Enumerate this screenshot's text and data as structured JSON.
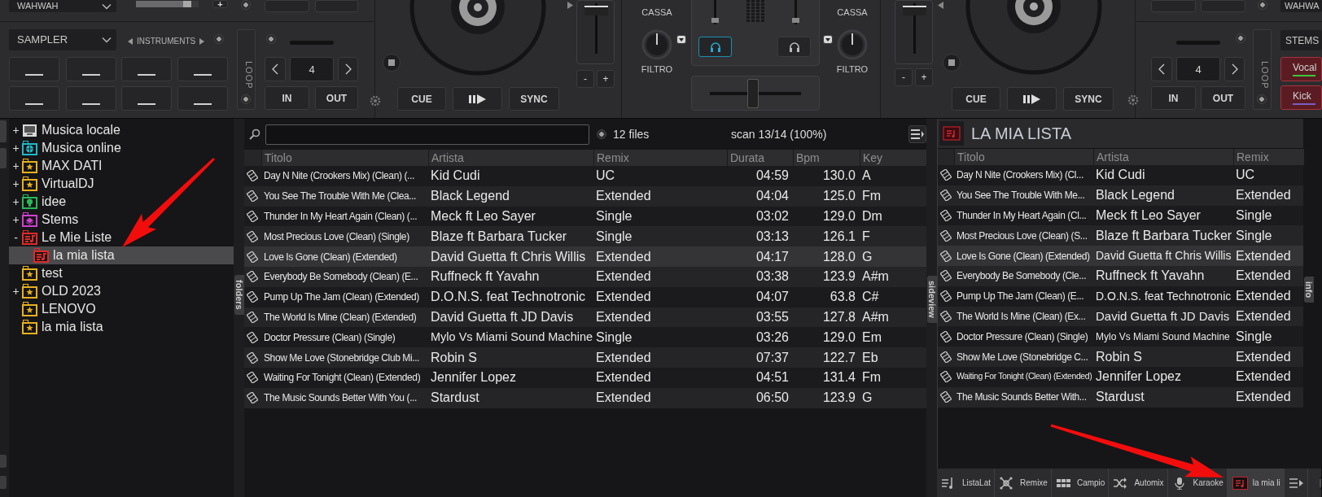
{
  "left_deck": {
    "effect": "WAHWAH",
    "effect_plus": "+",
    "effect_slider": {
      "level": 0.88
    },
    "sampler": "SAMPLER",
    "instruments": "INSTRUMENTS",
    "loop_label": "LOOP",
    "loop_size": "4",
    "loop_in": "IN",
    "loop_out": "OUT",
    "cue": "CUE",
    "sync": "SYNC",
    "pitch": {
      "level": 0.95
    },
    "pitch_minus": "-",
    "pitch_plus": "+"
  },
  "mixer": {
    "channels": [
      {
        "eq_label": "CASSA",
        "filter_label": "FILTRO",
        "volume": {
          "level": 0.1
        },
        "headphone_on": true
      },
      {
        "eq_label": "CASSA",
        "filter_label": "FILTRO",
        "volume": {
          "level": 0.1
        },
        "headphone_on": false
      }
    ],
    "crossfader": {
      "level": 0.47
    }
  },
  "right_deck": {
    "effect": "WAHWA",
    "stems": "STEMS",
    "stem_buttons": [
      {
        "label": "Vocal",
        "color": "#3cc43c"
      },
      {
        "label": "Kick",
        "color": "#7a5cc8"
      }
    ],
    "loop_label": "LOOP",
    "loop_size": "4",
    "loop_in": "IN",
    "loop_out": "OUT",
    "cue": "CUE",
    "sync": "SYNC",
    "pitch": {
      "level": 0.95
    },
    "pitch_minus": "-",
    "pitch_plus": "+"
  },
  "folders": [
    {
      "label": "Musica locale",
      "kind": "computer",
      "color": "#d8d8d8",
      "toggle": "+",
      "selected": false
    },
    {
      "label": "Musica online",
      "kind": "globe",
      "color": "#20b8c8",
      "toggle": "+",
      "selected": false
    },
    {
      "label": "MAX DATI",
      "kind": "star",
      "color": "#e8b020",
      "toggle": "+",
      "selected": false
    },
    {
      "label": "VirtualDJ",
      "kind": "star",
      "color": "#e8b020",
      "toggle": "+",
      "selected": false
    },
    {
      "label": "idee",
      "kind": "bulb",
      "color": "#28b858",
      "toggle": "+",
      "selected": false
    },
    {
      "label": "Stems",
      "kind": "stems",
      "color": "#d040d0",
      "toggle": "+",
      "selected": false
    },
    {
      "label": "Le Mie Liste",
      "kind": "playlist",
      "color": "#e02a2a",
      "toggle": "-",
      "selected": false,
      "children": [
        {
          "label": "la mia lista",
          "kind": "playlist",
          "color": "#e02a2a",
          "selected": true
        }
      ]
    },
    {
      "label": "test",
      "kind": "star",
      "color": "#e8b020",
      "selected": false
    },
    {
      "label": "OLD 2023",
      "kind": "star",
      "color": "#e8b020",
      "toggle": "+",
      "selected": false
    },
    {
      "label": "LENOVO",
      "kind": "star",
      "color": "#e8b020",
      "selected": false
    },
    {
      "label": "la mia lista",
      "kind": "star",
      "color": "#e8b020",
      "selected": false
    }
  ],
  "folders_tab": "folders",
  "browser": {
    "file_count": "12 files",
    "scan_status": "scan 13/14 (100%)",
    "columns": [
      "Titolo",
      "Artista",
      "Remix",
      "Durata",
      "Bpm",
      "Key"
    ],
    "rows": [
      {
        "title": "Day N Nite (Crookers Mix) (Clean) (...",
        "artist": "Kid Cudi",
        "remix": "UC",
        "duration": "04:59",
        "bpm": "130.0",
        "key": "A",
        "selected": false
      },
      {
        "title": "You See The Trouble With Me (Clea...",
        "artist": "Black Legend",
        "remix": "Extended",
        "duration": "04:04",
        "bpm": "125.0",
        "key": "Fm",
        "selected": false
      },
      {
        "title": "Thunder In My Heart Again (Clean) (...",
        "artist": "Meck ft Leo Sayer",
        "remix": "Single",
        "duration": "03:02",
        "bpm": "129.0",
        "key": "Dm",
        "selected": false
      },
      {
        "title": "Most Precious Love (Clean) (Single)",
        "artist": "Blaze ft Barbara Tucker",
        "remix": "Single",
        "duration": "03:13",
        "bpm": "126.1",
        "key": "F",
        "selected": false
      },
      {
        "title": "Love Is Gone (Clean) (Extended)",
        "artist": "David Guetta ft Chris Willis",
        "remix": "Extended",
        "duration": "04:17",
        "bpm": "128.0",
        "key": "G",
        "selected": true
      },
      {
        "title": "Everybody Be Somebody (Clean) (E...",
        "artist": "Ruffneck ft Yavahn",
        "remix": "Extended",
        "duration": "03:38",
        "bpm": "123.9",
        "key": "A#m",
        "selected": false
      },
      {
        "title": "Pump Up The Jam (Clean) (Extended)",
        "artist": "D.O.N.S. feat Technotronic",
        "remix": "Extended",
        "duration": "04:07",
        "bpm": "63.8",
        "key": "C#",
        "selected": false
      },
      {
        "title": "The World Is Mine (Clean) (Extended)",
        "artist": "David Guetta ft JD Davis",
        "remix": "Extended",
        "duration": "03:55",
        "bpm": "127.8",
        "key": "A#m",
        "selected": false
      },
      {
        "title": "Doctor Pressure (Clean) (Single)",
        "artist": "Mylo Vs Miami Sound Machine",
        "remix": "Single",
        "duration": "03:26",
        "bpm": "129.0",
        "key": "Em",
        "selected": false
      },
      {
        "title": "Show Me Love (Stonebridge Club Mi...",
        "artist": "Robin S",
        "remix": "Extended",
        "duration": "07:37",
        "bpm": "122.7",
        "key": "Eb",
        "selected": false
      },
      {
        "title": "Waiting For Tonight (Clean) (Extended)",
        "artist": "Jennifer Lopez",
        "remix": "Extended",
        "duration": "04:51",
        "bpm": "131.4",
        "key": "Fm",
        "selected": false
      },
      {
        "title": "The Music Sounds Better With You (...",
        "artist": "Stardust",
        "remix": "Extended",
        "duration": "06:50",
        "bpm": "123.9",
        "key": "G",
        "selected": false
      }
    ]
  },
  "sideview_tab": "sideview",
  "sideview": {
    "title": "LA MIA LISTA",
    "columns": [
      "Titolo",
      "Artista",
      "Remix"
    ],
    "rows": [
      {
        "title": "Day N Nite (Crookers Mix) (Cl...",
        "artist": "Kid Cudi",
        "remix": "UC",
        "selected": false
      },
      {
        "title": "You See The Trouble With Me...",
        "artist": "Black Legend",
        "remix": "Extended",
        "selected": false
      },
      {
        "title": "Thunder In My Heart Again (Cl...",
        "artist": "Meck ft Leo Sayer",
        "remix": "Single",
        "selected": false
      },
      {
        "title": "Most Precious Love (Clean) (S...",
        "artist": "Blaze ft Barbara Tucker",
        "remix": "Single",
        "selected": false
      },
      {
        "title": "Love Is Gone (Clean) (Extended)",
        "artist": "David Guetta ft Chris Willis",
        "remix": "Extended",
        "selected": true
      },
      {
        "title": "Everybody Be Somebody (Cle...",
        "artist": "Ruffneck ft Yavahn",
        "remix": "Extended",
        "selected": false
      },
      {
        "title": "Pump Up The Jam (Clean) (E...",
        "artist": "D.O.N.S. feat Technotronic",
        "remix": "Extended",
        "selected": false
      },
      {
        "title": "The World Is Mine (Clean) (Ex...",
        "artist": "David Guetta ft JD Davis",
        "remix": "Extended",
        "selected": false
      },
      {
        "title": "Doctor Pressure (Clean) (Single)",
        "artist": "Mylo Vs Miami Sound Machine",
        "remix": "Single",
        "selected": false
      },
      {
        "title": "Show Me Love (Stonebridge C...",
        "artist": "Robin S",
        "remix": "Extended",
        "selected": false
      },
      {
        "title": "Waiting For Tonight (Clean) (Extended)",
        "artist": "Jennifer Lopez",
        "remix": "Extended",
        "selected": false
      },
      {
        "title": "The Music Sounds Better With...",
        "artist": "Stardust",
        "remix": "Extended",
        "selected": false
      }
    ],
    "tabs": [
      {
        "label": "ListaLat",
        "kind": "list",
        "selected": false
      },
      {
        "label": "Remixe",
        "kind": "remix",
        "selected": false
      },
      {
        "label": "Campio",
        "kind": "grid",
        "selected": false
      },
      {
        "label": "Automix",
        "kind": "shuffle",
        "selected": false
      },
      {
        "label": "Karaoke",
        "kind": "mic",
        "selected": false
      },
      {
        "label": "la mia li",
        "kind": "playlist",
        "selected": true
      }
    ]
  },
  "info_tab": "info"
}
